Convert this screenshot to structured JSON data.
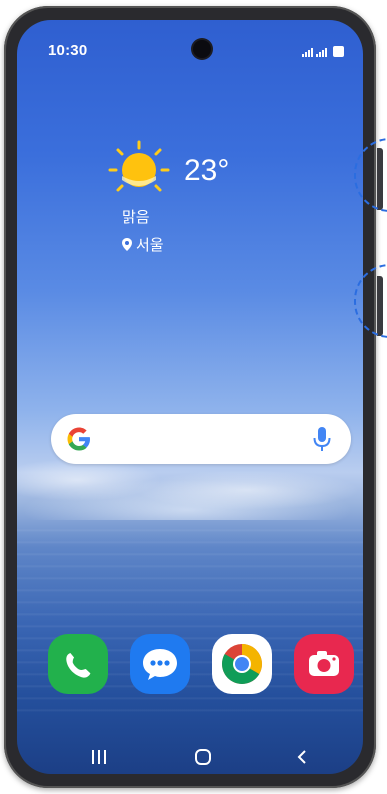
{
  "status_bar": {
    "time": "10:30"
  },
  "weather": {
    "icon": "sun-icon",
    "temperature": "23°",
    "condition": "맑음",
    "location": "서울"
  },
  "search": {
    "logo": "google-g-icon",
    "mic": "mic-icon"
  },
  "dock": {
    "apps": [
      {
        "name": "phone",
        "icon": "phone-handset-icon",
        "color": "#22b14c"
      },
      {
        "name": "messages",
        "icon": "chat-bubble-icon",
        "color": "#1f7af0"
      },
      {
        "name": "chrome",
        "icon": "chrome-icon",
        "color": "#ffffff"
      },
      {
        "name": "camera",
        "icon": "camera-icon",
        "color": "#e8284f"
      }
    ]
  },
  "nav": {
    "recents": "recents-icon",
    "home": "home-icon",
    "back": "back-icon"
  },
  "colors": {
    "highlight_dashed": "#2b6de0"
  }
}
